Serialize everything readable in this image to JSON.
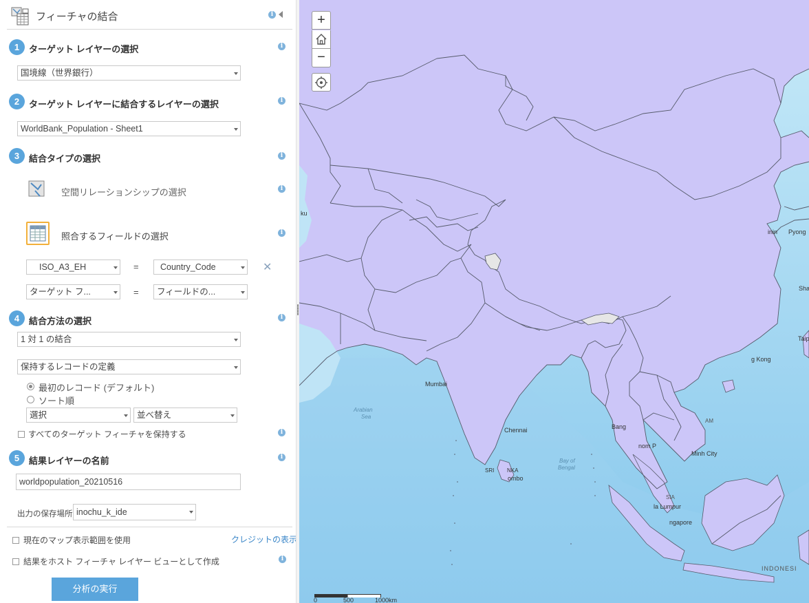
{
  "panel": {
    "title": "フィーチャの結合",
    "step1": {
      "num": "1",
      "label": "ターゲット レイヤーの選択",
      "value": "国境線（世界銀行）"
    },
    "step2": {
      "num": "2",
      "label": "ターゲット レイヤーに結合するレイヤーの選択",
      "value": "WorldBank_Population - Sheet1"
    },
    "step3": {
      "num": "3",
      "label": "結合タイプの選択",
      "spatial_label": "空間リレーションシップの選択",
      "fields_label": "照合するフィールドの選択",
      "row1": {
        "left": "ISO_A3_EH",
        "eq": "=",
        "right": "Country_Code"
      },
      "row2": {
        "left": "ターゲット フ...",
        "eq": "=",
        "right": "フィールドの..."
      }
    },
    "step4": {
      "num": "4",
      "label": "結合方法の選択",
      "method": "1 対 1 の結合",
      "records": "保持するレコードの定義",
      "radio1": "最初のレコード (デフォルト)",
      "radio2": "ソート順",
      "select": "選択",
      "sort": "並べ替え",
      "keep_all": "すべてのターゲット フィーチャを保持する"
    },
    "step5": {
      "num": "5",
      "label": "結果レイヤーの名前",
      "value": "worldpopulation_20210516"
    },
    "save_label": "出力の保存場所:",
    "save_value": "inochu_k_ide",
    "use_extent": "現在のマップ表示範囲を使用",
    "credits": "クレジットの表示",
    "hosted_view": "結果をホスト フィーチャ レイヤー ビューとして作成",
    "run": "分析の実行"
  },
  "map": {
    "zoom_in": "+",
    "zoom_out": "−",
    "labels": {
      "mumbai": "Mumbai",
      "chennai": "Chennai",
      "arabian": "Arabian",
      "sea": "Sea",
      "bay": "Bay of",
      "bengal": "Bengal",
      "hongkong": "g Kong",
      "taipei": "Taipe",
      "sri": "SRI",
      "lanka": "NKA",
      "colombo": "ombo",
      "bang": "Bang",
      "phnom": "nom P",
      "minh": "Minh City",
      "lumpur": "la Lumpur",
      "singapore": "ngapore",
      "indonesia": "INDONESI",
      "am": "AM",
      "sia": "SIA",
      "shan": "Shan",
      "pyong": "Pyong",
      "jinin": "inin",
      "ku": "ku"
    },
    "scale": {
      "s0": "0",
      "s1": "500",
      "s2": "1000km"
    },
    "colors": {
      "water": "#a9d8f2",
      "land": "#ccc6f8",
      "border": "#555a6a"
    }
  }
}
